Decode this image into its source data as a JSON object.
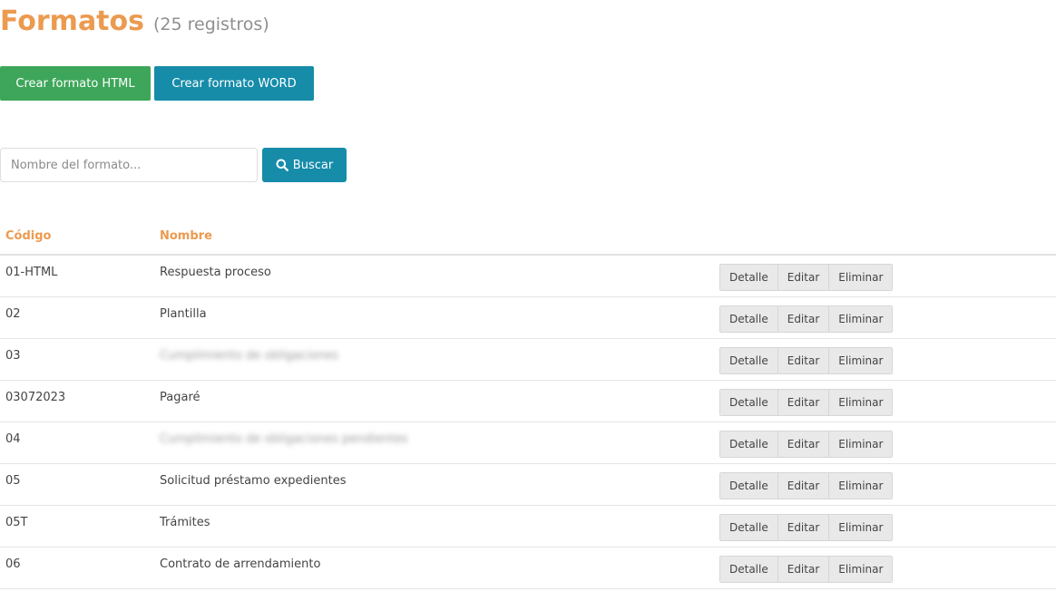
{
  "header": {
    "title": "Formatos",
    "count": "(25 registros)"
  },
  "buttons": {
    "create_html": "Crear formato HTML",
    "create_word": "Crear formato WORD"
  },
  "search": {
    "placeholder": "Nombre del formato...",
    "button_label": "Buscar",
    "button_icon": "search-icon"
  },
  "table": {
    "headers": [
      "Código",
      "Nombre"
    ],
    "actions": [
      "Detalle",
      "Editar",
      "Eliminar"
    ],
    "rows": [
      {
        "code": "01-HTML",
        "name": "Respuesta proceso"
      },
      {
        "code": "02",
        "name": "Plantilla"
      },
      {
        "code": "03",
        "name": "Cumplimiento de obligaciones"
      },
      {
        "code": "03072023",
        "name": "Pagaré"
      },
      {
        "code": "04",
        "name": "Cumplimiento de obligaciones pendientes"
      },
      {
        "code": "05",
        "name": "Solicitud préstamo expedientes"
      },
      {
        "code": "05T",
        "name": "Trámites"
      },
      {
        "code": "06",
        "name": "Contrato de arrendamiento"
      }
    ]
  }
}
